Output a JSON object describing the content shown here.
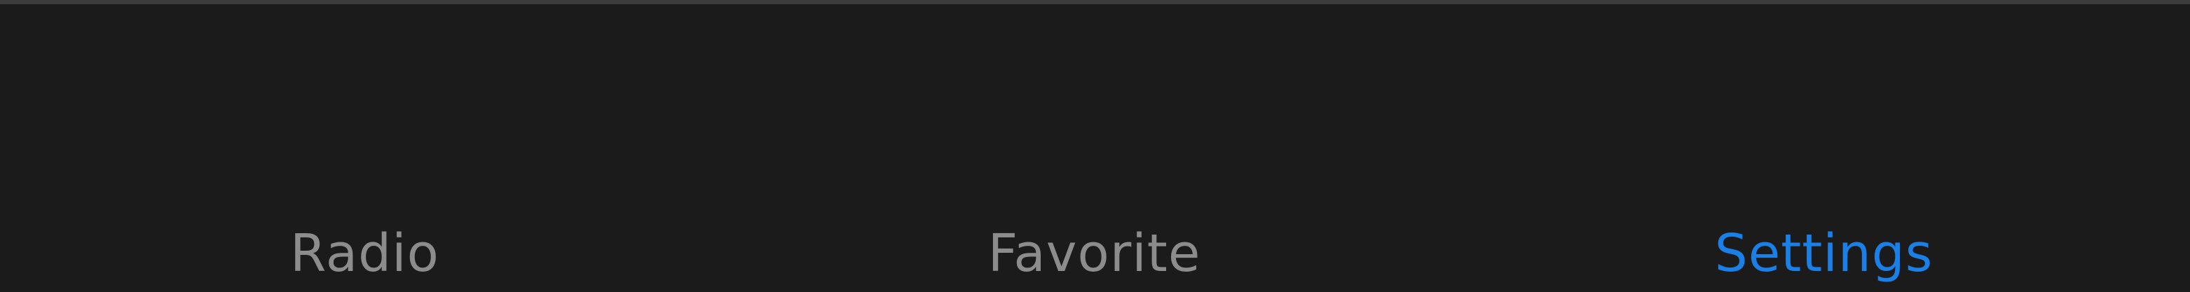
{
  "tab_bar": {
    "tabs": [
      {
        "label": "Radio",
        "active": false
      },
      {
        "label": "Favorite",
        "active": false
      },
      {
        "label": "Settings",
        "active": true
      }
    ]
  },
  "colors": {
    "background": "#1b1b1b",
    "top_border": "#3c3c3c",
    "inactive_label": "#8c8c8c",
    "active_label": "#1a7fe6"
  }
}
